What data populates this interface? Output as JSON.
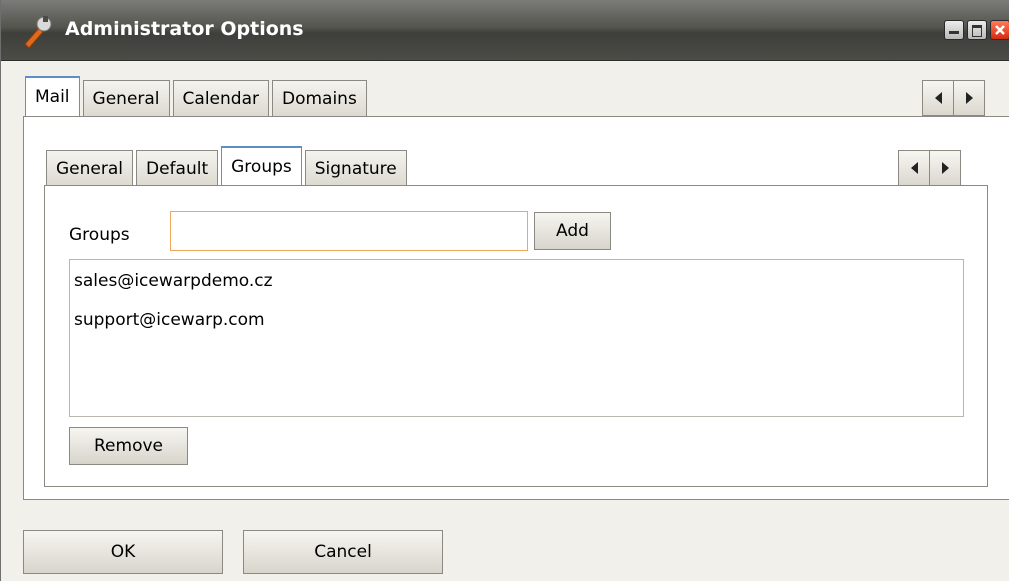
{
  "window": {
    "title": "Administrator Options"
  },
  "outer_tabs": [
    {
      "label": "Mail",
      "active": true
    },
    {
      "label": "General",
      "active": false
    },
    {
      "label": "Calendar",
      "active": false
    },
    {
      "label": "Domains",
      "active": false
    }
  ],
  "inner_tabs": [
    {
      "label": "General",
      "active": false
    },
    {
      "label": "Default",
      "active": false
    },
    {
      "label": "Groups",
      "active": true
    },
    {
      "label": "Signature",
      "active": false
    }
  ],
  "groups": {
    "label": "Groups",
    "input_value": "",
    "add_label": "Add",
    "items": [
      "sales@icewarpdemo.cz",
      "support@icewarp.com"
    ],
    "remove_label": "Remove"
  },
  "footer": {
    "ok_label": "OK",
    "cancel_label": "Cancel"
  },
  "icons": {
    "app": "wrench-icon",
    "minimize": "minimize-icon",
    "maximize": "maximize-icon",
    "close": "close-icon",
    "prev": "arrow-left-icon",
    "next": "arrow-right-icon"
  },
  "colors": {
    "title_bar": "#4c4c47",
    "active_tab_accent": "#5c8ec8",
    "input_focus": "#f0a65c",
    "close_button": "#d22b10"
  }
}
